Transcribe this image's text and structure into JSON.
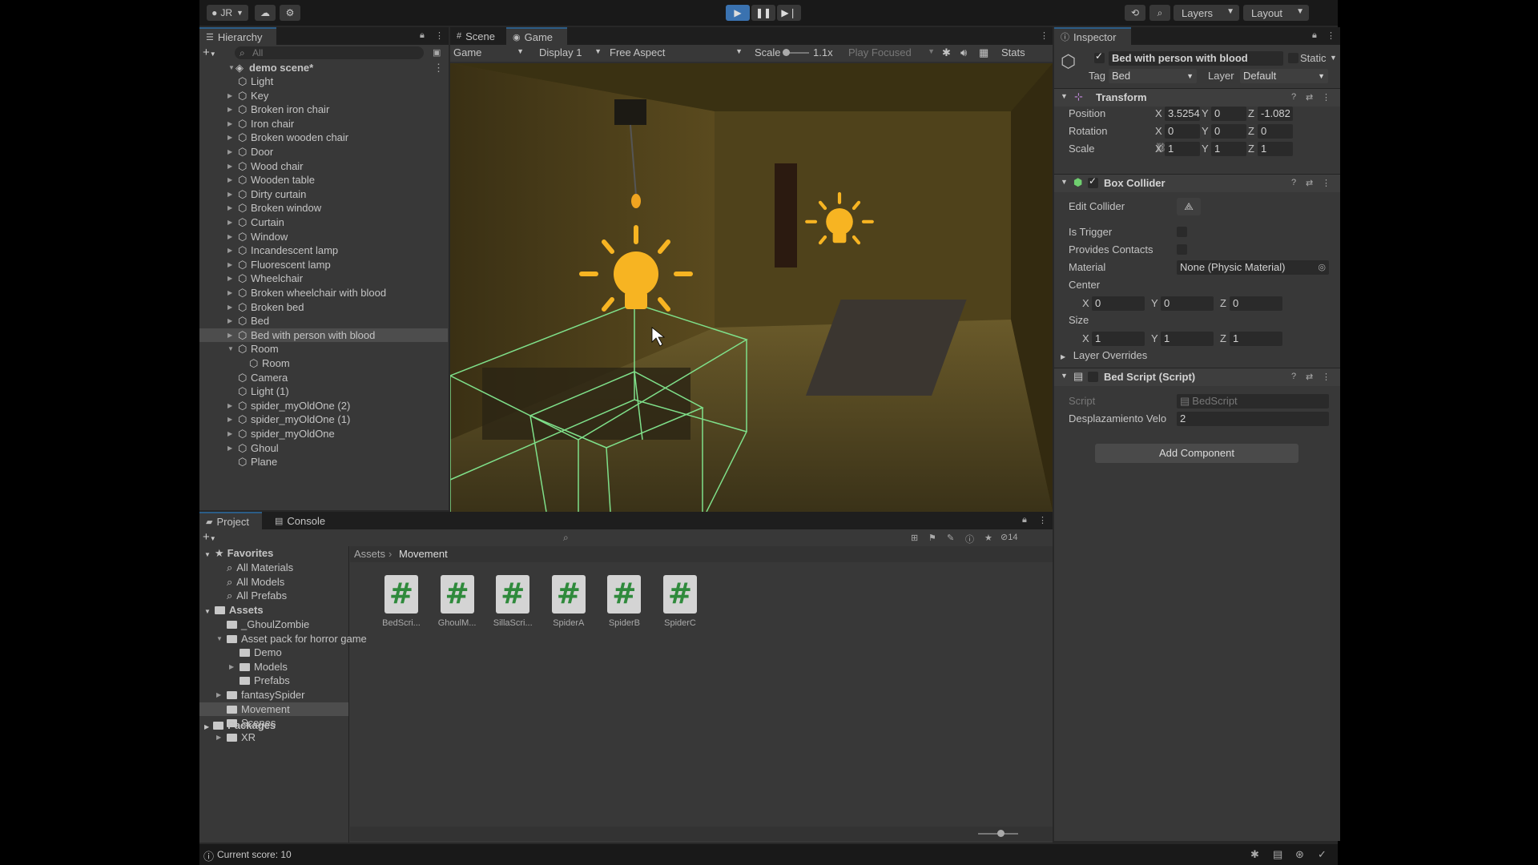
{
  "toolbar": {
    "account": "JR",
    "layers_label": "Layers",
    "layout_label": "Layout"
  },
  "hierarchy": {
    "tab": "Hierarchy",
    "search_placeholder": "All",
    "scene": "demo scene*",
    "items": [
      {
        "name": "Light",
        "fold": false,
        "indent": 1
      },
      {
        "name": "Key",
        "fold": true,
        "indent": 1
      },
      {
        "name": "Broken iron chair",
        "fold": true,
        "indent": 1
      },
      {
        "name": "Iron chair",
        "fold": true,
        "indent": 1
      },
      {
        "name": "Broken wooden chair",
        "fold": true,
        "indent": 1
      },
      {
        "name": "Door",
        "fold": true,
        "indent": 1
      },
      {
        "name": "Wood chair",
        "fold": true,
        "indent": 1
      },
      {
        "name": "Wooden table",
        "fold": true,
        "indent": 1
      },
      {
        "name": "Dirty curtain",
        "fold": true,
        "indent": 1
      },
      {
        "name": "Broken window",
        "fold": true,
        "indent": 1
      },
      {
        "name": "Curtain",
        "fold": true,
        "indent": 1
      },
      {
        "name": "Window",
        "fold": true,
        "indent": 1
      },
      {
        "name": "Incandescent lamp",
        "fold": true,
        "indent": 1
      },
      {
        "name": "Fluorescent lamp",
        "fold": true,
        "indent": 1
      },
      {
        "name": "Wheelchair",
        "fold": true,
        "indent": 1
      },
      {
        "name": "Broken wheelchair with blood",
        "fold": true,
        "indent": 1
      },
      {
        "name": "Broken bed",
        "fold": true,
        "indent": 1
      },
      {
        "name": "Bed",
        "fold": true,
        "indent": 1
      },
      {
        "name": "Bed with person with blood",
        "fold": true,
        "indent": 1,
        "selected": true
      },
      {
        "name": "Room",
        "fold": true,
        "open": true,
        "indent": 1
      },
      {
        "name": "Room",
        "fold": false,
        "indent": 2
      },
      {
        "name": "Camera",
        "fold": false,
        "indent": 1
      },
      {
        "name": "Light (1)",
        "fold": false,
        "indent": 1
      },
      {
        "name": "spider_myOldOne (2)",
        "fold": true,
        "indent": 1
      },
      {
        "name": "spider_myOldOne (1)",
        "fold": true,
        "indent": 1
      },
      {
        "name": "spider_myOldOne",
        "fold": true,
        "indent": 1
      },
      {
        "name": "Ghoul",
        "fold": true,
        "indent": 1
      },
      {
        "name": "Plane",
        "fold": false,
        "indent": 1
      }
    ]
  },
  "view": {
    "tab_scene": "Scene",
    "tab_game": "Game",
    "game_dropdown": "Game",
    "display_dropdown": "Display 1",
    "aspect_dropdown": "Free Aspect",
    "scale_label": "Scale",
    "scale_value": "1.1x",
    "play_mode": "Play Focused",
    "stats": "Stats"
  },
  "inspector": {
    "tab": "Inspector",
    "object_name": "Bed with person with blood",
    "static_label": "Static",
    "tag_label": "Tag",
    "tag_value": "Bed",
    "layer_label": "Layer",
    "layer_value": "Default",
    "transform": {
      "title": "Transform",
      "position_label": "Position",
      "rotation_label": "Rotation",
      "scale_label": "Scale",
      "position": {
        "x": "3.5254",
        "y": "0",
        "z": "-1.082"
      },
      "rotation": {
        "x": "0",
        "y": "0",
        "z": "0"
      },
      "scale": {
        "x": "1",
        "y": "1",
        "z": "1"
      }
    },
    "box_collider": {
      "title": "Box Collider",
      "edit_collider": "Edit Collider",
      "is_trigger": "Is Trigger",
      "provides_contacts": "Provides Contacts",
      "material_label": "Material",
      "material_value": "None (Physic Material)",
      "center_label": "Center",
      "center": {
        "x": "0",
        "y": "0",
        "z": "0"
      },
      "size_label": "Size",
      "size": {
        "x": "1",
        "y": "1",
        "z": "1"
      },
      "layer_overrides": "Layer Overrides"
    },
    "bed_script": {
      "title": "Bed Script (Script)",
      "script_label": "Script",
      "script_value": "BedScript",
      "field_label": "Desplazamiento Velo",
      "field_value": "2"
    },
    "add_component": "Add Component"
  },
  "project": {
    "tab_project": "Project",
    "tab_console": "Console",
    "hidden_count": "14",
    "breadcrumb": [
      "Assets",
      "Movement"
    ],
    "favorites_label": "Favorites",
    "favorites": [
      "All Materials",
      "All Models",
      "All Prefabs"
    ],
    "assets_label": "Assets",
    "tree": [
      {
        "name": "_GhoulZombie",
        "indent": 1,
        "fold": false
      },
      {
        "name": "Asset pack for horror game",
        "indent": 1,
        "fold": true,
        "open": true
      },
      {
        "name": "Demo",
        "indent": 2,
        "fold": false
      },
      {
        "name": "Models",
        "indent": 2,
        "fold": true
      },
      {
        "name": "Prefabs",
        "indent": 2,
        "fold": false
      },
      {
        "name": "fantasySpider",
        "indent": 1,
        "fold": true
      },
      {
        "name": "Movement",
        "indent": 1,
        "fold": false,
        "selected": true
      },
      {
        "name": "Scenes",
        "indent": 1,
        "fold": false
      },
      {
        "name": "XR",
        "indent": 1,
        "fold": true
      }
    ],
    "packages_label": "Packages",
    "files": [
      "BedScri...",
      "GhoulM...",
      "SillaScri...",
      "SpiderA",
      "SpiderB",
      "SpiderC"
    ]
  },
  "status": {
    "message": "Current score: 10"
  },
  "icons": {
    "script": "csharp-script-icon",
    "folder": "folder-icon",
    "gameobject": "cube-icon"
  },
  "colors": {
    "selection": "#2c5d87",
    "play_active": "#3a72b0",
    "collider_green": "#7fe08a",
    "light_icon": "#f7b422"
  }
}
